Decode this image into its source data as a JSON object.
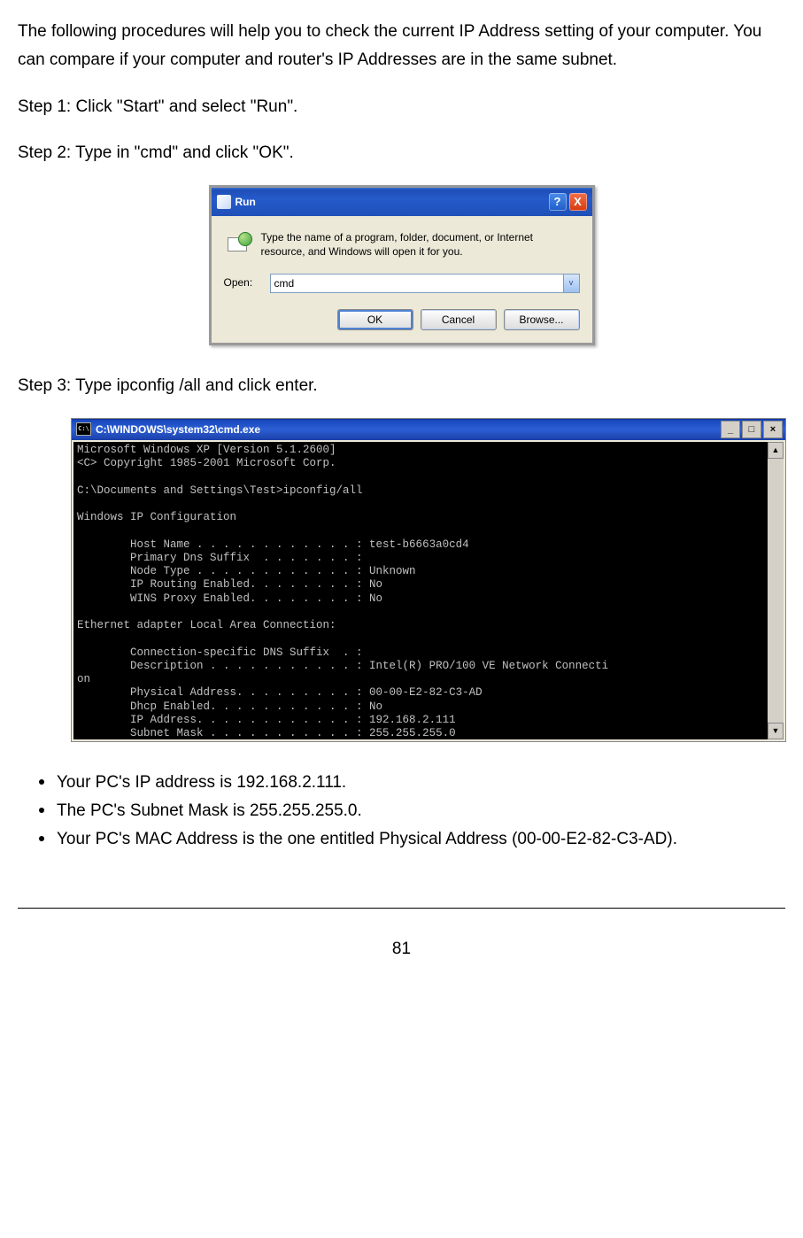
{
  "intro": "The following procedures will help you to check the current IP Address setting of your computer. You can compare if your computer and router's IP Addresses are in the same subnet.",
  "steps": {
    "s1": "Step 1: Click \"Start\" and select \"Run\".",
    "s2": "Step 2: Type in \"cmd\" and click \"OK\".",
    "s3": "Step 3: Type ipconfig /all and click enter."
  },
  "run_dialog": {
    "title": "Run",
    "help_glyph": "?",
    "close_glyph": "X",
    "description": "Type the name of a program, folder, document, or Internet resource, and Windows will open it for you.",
    "open_label": "Open:",
    "input_value": "cmd",
    "dd_glyph": "v",
    "buttons": {
      "ok": "OK",
      "cancel": "Cancel",
      "browse": "Browse..."
    }
  },
  "cmd": {
    "title": "C:\\WINDOWS\\system32\\cmd.exe",
    "min_glyph": "_",
    "max_glyph": "□",
    "close_glyph": "×",
    "scroll_up": "▲",
    "scroll_down": "▼",
    "body": "Microsoft Windows XP [Version 5.1.2600]\n<C> Copyright 1985-2001 Microsoft Corp.\n\nC:\\Documents and Settings\\Test>ipconfig/all\n\nWindows IP Configuration\n\n        Host Name . . . . . . . . . . . . : test-b6663a0cd4\n        Primary Dns Suffix  . . . . . . . :\n        Node Type . . . . . . . . . . . . : Unknown\n        IP Routing Enabled. . . . . . . . : No\n        WINS Proxy Enabled. . . . . . . . : No\n\nEthernet adapter Local Area Connection:\n\n        Connection-specific DNS Suffix  . :\n        Description . . . . . . . . . . . : Intel(R) PRO/100 VE Network Connecti\non\n        Physical Address. . . . . . . . . : 00-00-E2-82-C3-AD\n        Dhcp Enabled. . . . . . . . . . . : No\n        IP Address. . . . . . . . . . . . : 192.168.2.111\n        Subnet Mask . . . . . . . . . . . : 255.255.255.0\n        Default Gateway . . . . . . . . . :\n\nC:\\Documents and Settings\\Test>"
  },
  "bullets": {
    "b1": "Your PC's IP address is 192.168.2.111.",
    "b2": "The PC's Subnet Mask is 255.255.255.0.",
    "b3": "Your PC's MAC Address is the one entitled Physical Address (00-00-E2-82-C3-AD)."
  },
  "page_number": "81"
}
